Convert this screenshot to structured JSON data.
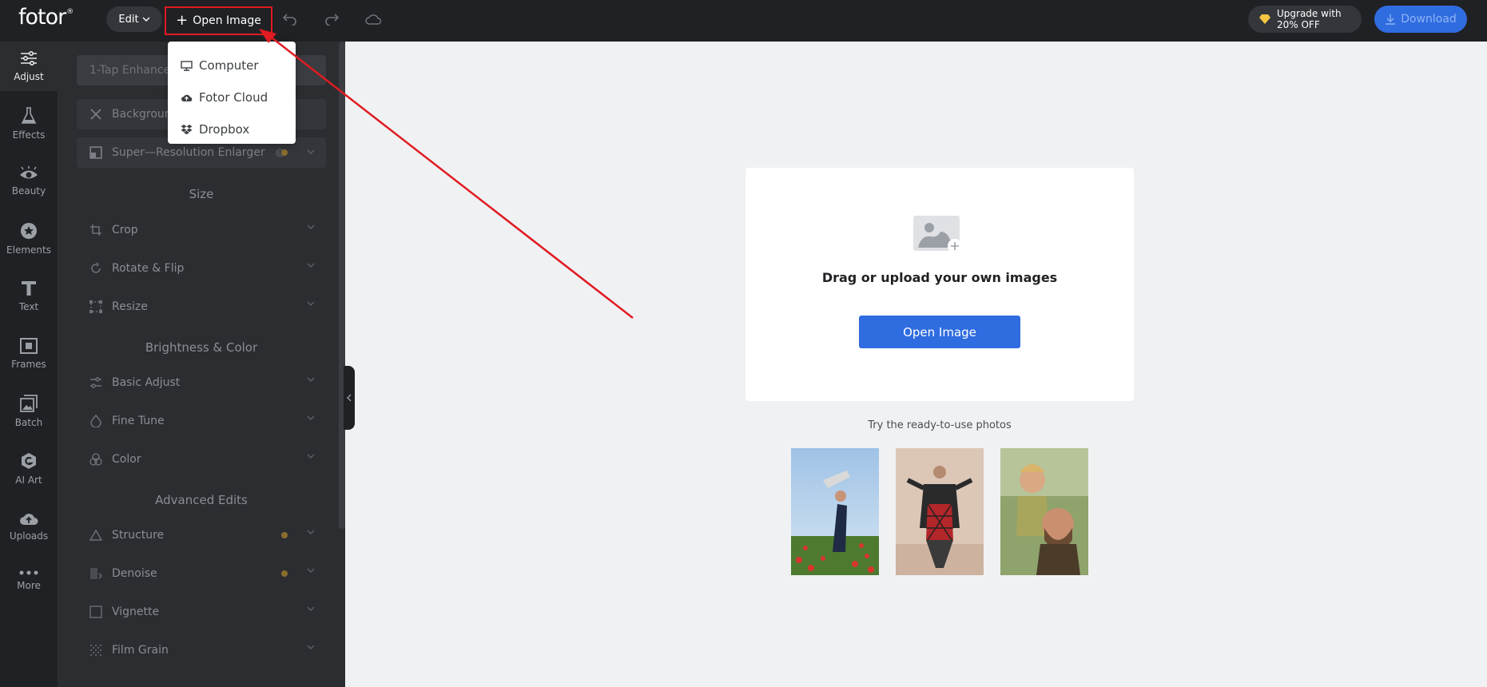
{
  "topbar": {
    "logo": "fotor",
    "logo_mark": "®",
    "edit_label": "Edit",
    "open_image_label": "Open Image",
    "upgrade_line1": "Upgrade with",
    "upgrade_line2": "20% OFF",
    "download_label": "Download"
  },
  "open_menu": {
    "items": [
      {
        "label": "Computer",
        "icon": "monitor-icon"
      },
      {
        "label": "Fotor Cloud",
        "icon": "cloud-upload-icon"
      },
      {
        "label": "Dropbox",
        "icon": "dropbox-icon"
      }
    ]
  },
  "leftnav": {
    "items": [
      {
        "label": "Adjust",
        "icon": "sliders-icon",
        "active": true
      },
      {
        "label": "Effects",
        "icon": "flask-icon"
      },
      {
        "label": "Beauty",
        "icon": "eye-icon"
      },
      {
        "label": "Elements",
        "icon": "star-icon"
      },
      {
        "label": "Text",
        "icon": "text-icon"
      },
      {
        "label": "Frames",
        "icon": "frame-icon"
      },
      {
        "label": "Batch",
        "icon": "batch-icon"
      },
      {
        "label": "AI Art",
        "icon": "ai-art-icon"
      },
      {
        "label": "Uploads",
        "icon": "upload-cloud-icon"
      },
      {
        "label": "More",
        "icon": "more-dots-icon"
      }
    ]
  },
  "panel": {
    "enhance_label": "1-Tap Enhance",
    "background_label": "Backgroun",
    "super_resolution_label": "Super—Resolution Enlarger",
    "sections": [
      {
        "title": "Size",
        "rows": [
          "Crop",
          "Rotate & Flip",
          "Resize"
        ]
      },
      {
        "title": "Brightness & Color",
        "rows": [
          "Basic Adjust",
          "Fine Tune",
          "Color"
        ]
      },
      {
        "title": "Advanced Edits",
        "rows": [
          "Structure",
          "Denoise",
          "Vignette",
          "Film Grain"
        ]
      }
    ]
  },
  "main": {
    "upload_text": "Drag or upload your own images",
    "open_image_button": "Open Image",
    "try_text": "Try the ready-to-use photos"
  },
  "colors": {
    "accent": "#2f6ce0",
    "highlight_red": "#e01b22",
    "dark_bg": "#202124",
    "panel_bg": "#2b2d31"
  }
}
